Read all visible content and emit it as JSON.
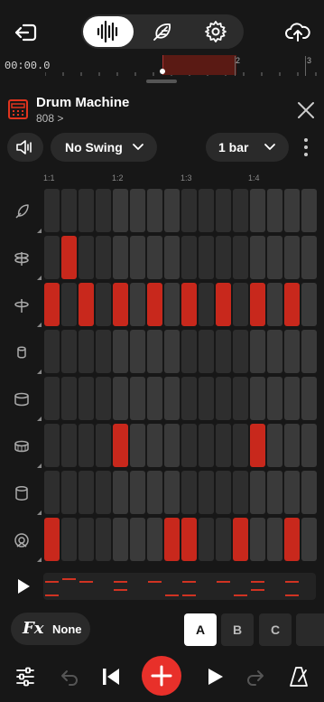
{
  "toolbar": {
    "modes": [
      {
        "name": "audio",
        "active": true
      },
      {
        "name": "feather",
        "active": false
      },
      {
        "name": "settings",
        "active": false
      }
    ]
  },
  "timeline": {
    "time": "00:00.0",
    "bar_numbers": [
      "2",
      "3"
    ]
  },
  "instrument": {
    "title": "Drum Machine",
    "kit": "808 >"
  },
  "controls": {
    "swing": "No Swing",
    "length": "1 bar"
  },
  "grid": {
    "beat_labels": [
      "1:1",
      "1:2",
      "1:3",
      "1:4"
    ],
    "tracks": [
      {
        "icon": "cowbell-icon",
        "steps": [
          0,
          0,
          0,
          0,
          0,
          0,
          0,
          0,
          0,
          0,
          0,
          0,
          0,
          0,
          0,
          0
        ]
      },
      {
        "icon": "hihat-open-icon",
        "steps": [
          0,
          1,
          0,
          0,
          0,
          0,
          0,
          0,
          0,
          0,
          0,
          0,
          0,
          0,
          0,
          0
        ]
      },
      {
        "icon": "hihat-closed-icon",
        "steps": [
          1,
          0,
          1,
          0,
          1,
          0,
          1,
          0,
          1,
          0,
          1,
          0,
          1,
          0,
          1,
          0
        ]
      },
      {
        "icon": "rimshot-icon",
        "steps": [
          0,
          0,
          0,
          0,
          0,
          0,
          0,
          0,
          0,
          0,
          0,
          0,
          0,
          0,
          0,
          0
        ]
      },
      {
        "icon": "tom-icon",
        "steps": [
          0,
          0,
          0,
          0,
          0,
          0,
          0,
          0,
          0,
          0,
          0,
          0,
          0,
          0,
          0,
          0
        ]
      },
      {
        "icon": "snare-icon",
        "steps": [
          0,
          0,
          0,
          0,
          1,
          0,
          0,
          0,
          0,
          0,
          0,
          0,
          1,
          0,
          0,
          0
        ]
      },
      {
        "icon": "clap-icon",
        "steps": [
          0,
          0,
          0,
          0,
          0,
          0,
          0,
          0,
          0,
          0,
          0,
          0,
          0,
          0,
          0,
          0
        ]
      },
      {
        "icon": "kick-icon",
        "steps": [
          1,
          0,
          0,
          0,
          0,
          0,
          0,
          1,
          1,
          0,
          0,
          1,
          0,
          0,
          1,
          0
        ]
      }
    ]
  },
  "fx": {
    "label": "Fx",
    "value": "None"
  },
  "patterns": {
    "items": [
      "A",
      "B",
      "C"
    ],
    "selected": "A"
  },
  "colors": {
    "accent": "#c8281c",
    "record": "#e8302a",
    "background": "#171717"
  }
}
